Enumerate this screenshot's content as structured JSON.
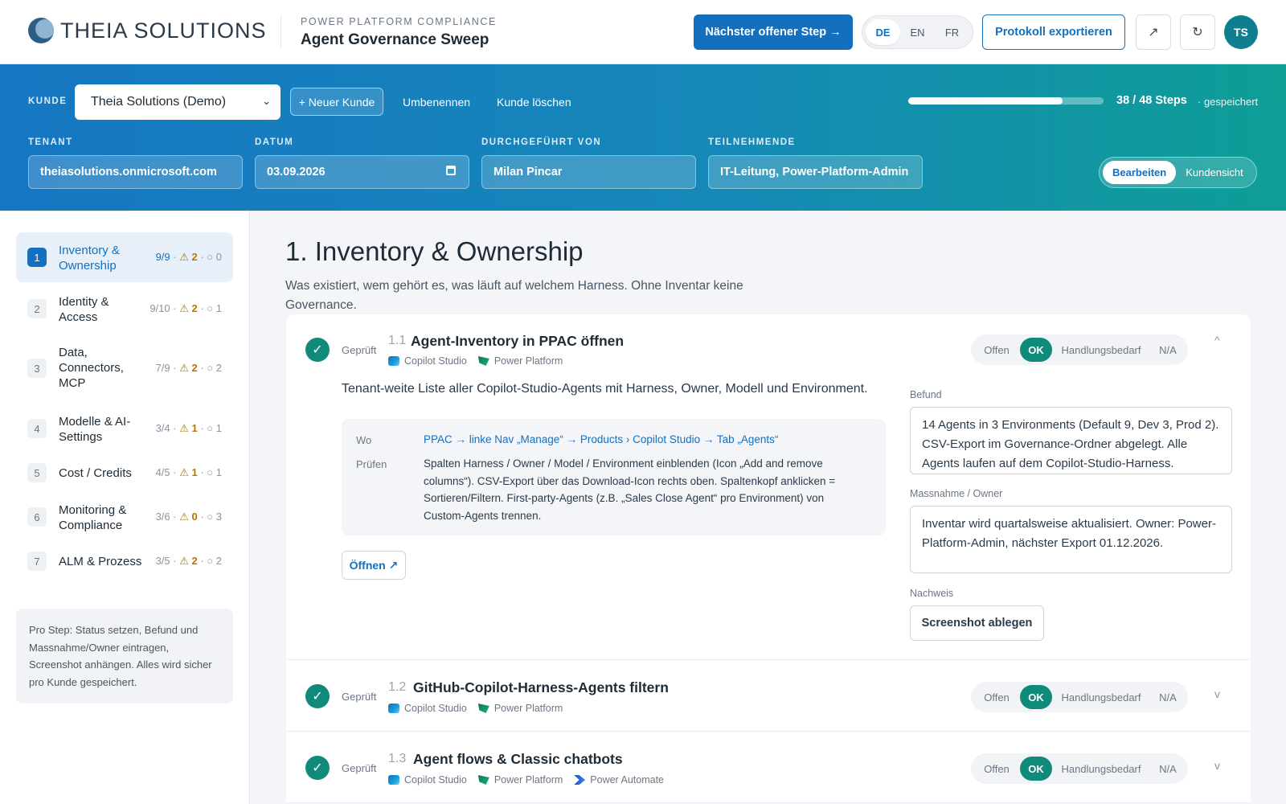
{
  "header": {
    "logo_text": "THEIA SOLUTIONS",
    "eyebrow": "POWER PLATFORM COMPLIANCE",
    "title": "Agent Governance Sweep",
    "next_button": "Nächster offener Step →",
    "languages": [
      "DE",
      "EN",
      "FR"
    ],
    "active_language": "DE",
    "export_button": "Protokoll exportieren",
    "external_icon": "↗",
    "refresh_icon": "↻",
    "avatar_initials": "TS"
  },
  "banner": {
    "kunde_label": "KUNDE",
    "kunde_value": "Theia Solutions (Demo)",
    "new_kunde": "+ Neuer Kunde",
    "rename": "Umbenennen",
    "delete": "Kunde löschen",
    "progress_text": "38 / 48 Steps",
    "progress_fraction": 0.79,
    "saved": "· gespeichert",
    "fields": {
      "tenant_label": "TENANT",
      "tenant_value": "theiasolutions.onmicrosoft.com",
      "datum_label": "DATUM",
      "datum_value": "03.09.2026",
      "durch_label": "DURCHGEFÜHRT VON",
      "durch_value": "Milan Pincar",
      "teil_label": "TEILNEHMENDE",
      "teil_value": "IT-Leitung, Power-Platform-Admin"
    },
    "view_edit": "Bearbeiten",
    "view_customer": "Kundensicht"
  },
  "sidebar": {
    "items": [
      {
        "num": "1",
        "label": "Inventory & Ownership",
        "count": "9/9",
        "warn": "2",
        "open": "0"
      },
      {
        "num": "2",
        "label": "Identity & Access",
        "count": "9/10",
        "warn": "2",
        "open": "1"
      },
      {
        "num": "3",
        "label": "Data, Connectors, MCP",
        "count": "7/9",
        "warn": "2",
        "open": "2"
      },
      {
        "num": "4",
        "label": "Modelle & AI-Settings",
        "count": "3/4",
        "warn": "1",
        "open": "1"
      },
      {
        "num": "5",
        "label": "Cost / Credits",
        "count": "4/5",
        "warn": "1",
        "open": "1"
      },
      {
        "num": "6",
        "label": "Monitoring & Compliance",
        "count": "3/6",
        "warn": "0",
        "open": "3"
      },
      {
        "num": "7",
        "label": "ALM & Prozess",
        "count": "3/5",
        "warn": "2",
        "open": "2"
      }
    ],
    "tip": "Pro Step: Status setzen, Befund und Massnahme/Owner eintragen, Screenshot anhängen. Alles wird sicher pro Kunde gespeichert."
  },
  "main": {
    "section_title": "1. Inventory & Ownership",
    "section_desc": "Was existiert, wem gehört es, was läuft auf welchem Harness. Ohne Inventar keine Governance.",
    "status_options": [
      "Offen",
      "OK",
      "Handlungsbedarf",
      "N/A"
    ],
    "steps": [
      {
        "num": "1.1",
        "title": "Agent-Inventory in PPAC öffnen",
        "state": "Geprüft",
        "tags": [
          "Copilot Studio",
          "Power Platform"
        ],
        "desc": "Tenant-weite Liste aller Copilot-Studio-Agents mit Harness, Owner, Modell und Environment.",
        "wo_label": "Wo",
        "wo": "PPAC → linke Nav „Manage“ → Products › Copilot Studio → Tab „Agents“",
        "pruefen_label": "Prüfen",
        "pruefen": "Spalten Harness / Owner / Model / Environment einblenden (Icon „Add and remove columns“). CSV-Export über das Download-Icon rechts oben. Spaltenkopf anklicken = Sortieren/Filtern. First-party-Agents (z.B. „Sales Close Agent“ pro Environment) von Custom-Agents trennen.",
        "open_button": "Öffnen ↗",
        "befund_label": "Befund",
        "befund": "14 Agents in 3 Environments (Default 9, Dev 3, Prod 2). CSV-Export im Governance-Ordner abgelegt. Alle Agents laufen auf dem Copilot-Studio-Harness.",
        "massnahme_label": "Massnahme / Owner",
        "massnahme": "Inventar wird quartalsweise aktualisiert. Owner: Power-Platform-Admin, nächster Export 01.12.2026.",
        "nachweis_label": "Nachweis",
        "nachweis_button": "Screenshot ablegen"
      },
      {
        "num": "1.2",
        "title": "GitHub-Copilot-Harness-Agents filtern",
        "state": "Geprüft",
        "tags": [
          "Copilot Studio",
          "Power Platform"
        ]
      },
      {
        "num": "1.3",
        "title": "Agent flows & Classic chatbots",
        "state": "Geprüft",
        "tags": [
          "Copilot Studio",
          "Power Platform",
          "Power Automate"
        ]
      }
    ]
  },
  "colors": {
    "primary": "#1470bf",
    "ok": "#108a7a",
    "warn": "#b07a00"
  },
  "icons": {
    "check": "✓",
    "chevron_up": "^",
    "chevron_down": "v",
    "select_chevron": "⌄"
  }
}
